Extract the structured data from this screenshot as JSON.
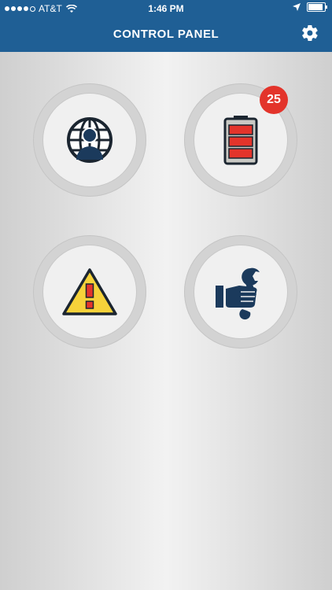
{
  "status_bar": {
    "carrier": "AT&T",
    "time": "1:46 PM"
  },
  "header": {
    "title": "CONTROL PANEL"
  },
  "tiles": [
    {
      "icon": "globe-user-icon"
    },
    {
      "icon": "battery-icon",
      "badge": "25"
    },
    {
      "icon": "warning-icon"
    },
    {
      "icon": "wrench-hand-icon"
    }
  ],
  "colors": {
    "header": "#1f5f95",
    "badge": "#e3342b",
    "battery_cell": "#e3342b",
    "warning": "#f6d23a",
    "icon_dark": "#1b3a5c"
  }
}
